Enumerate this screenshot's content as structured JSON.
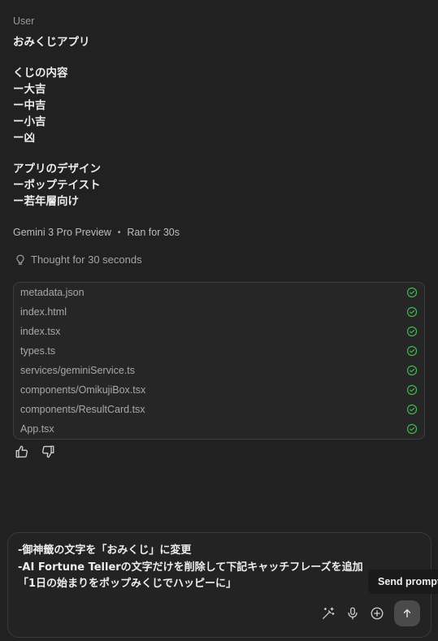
{
  "role_label": "User",
  "user_message": {
    "lines": [
      "おみくじアプリ",
      "",
      "くじの内容",
      "ー大吉",
      "ー中吉",
      "ー小吉",
      "ー凶",
      "",
      "アプリのデザイン",
      "ーポップテイスト",
      "ー若年層向け"
    ]
  },
  "model_meta": {
    "model": "Gemini 3 Pro Preview",
    "separator": "•",
    "run_time": "Ran for 30s"
  },
  "thought": {
    "label": "Thought for 30 seconds",
    "icon": "lightbulb-icon"
  },
  "files": [
    {
      "name": "metadata.json",
      "status": "done"
    },
    {
      "name": "index.html",
      "status": "done"
    },
    {
      "name": "index.tsx",
      "status": "done"
    },
    {
      "name": "types.ts",
      "status": "done"
    },
    {
      "name": "services/geminiService.ts",
      "status": "done"
    },
    {
      "name": "components/OmikujiBox.tsx",
      "status": "done"
    },
    {
      "name": "components/ResultCard.tsx",
      "status": "done"
    },
    {
      "name": "App.tsx",
      "status": "done"
    }
  ],
  "status_color": "#3fb950",
  "composer": {
    "lines": [
      "-御神籤の文字を「おみくじ」に変更",
      "-AI Fortune Tellerの文字だけを削除して下記キャッチフレーズを追加",
      "「1日の始まりをポップみくじでハッピーに」"
    ]
  },
  "tooltip": "Send prompt"
}
